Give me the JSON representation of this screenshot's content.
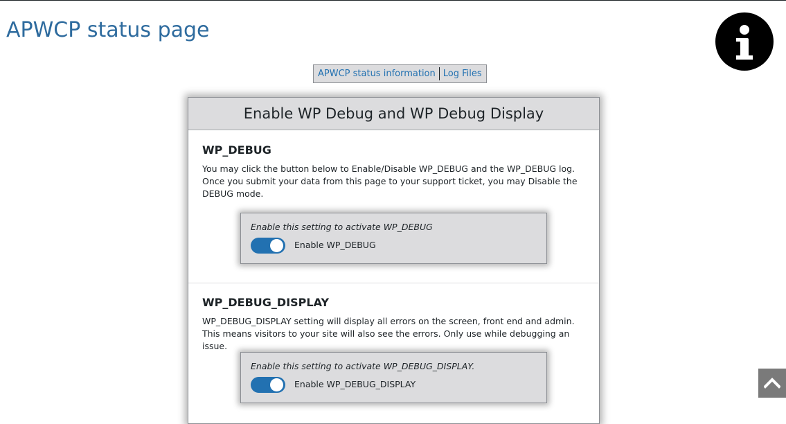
{
  "page": {
    "title": "APWCP status page"
  },
  "icons": {
    "info": "info-icon",
    "scroll_top": "chevron-up-icon"
  },
  "tabs": [
    {
      "label": "APWCP status information"
    },
    {
      "label": "Log Files"
    }
  ],
  "card": {
    "title": "Enable WP Debug and WP Debug Display",
    "sections": [
      {
        "title": "WP_DEBUG",
        "description": "You may click the button below to Enable/Disable WP_DEBUG and the WP_DEBUG log. Once you submit your data from this page to your support ticket, you may Disable the DEBUG mode.",
        "setting_hint": "Enable this setting to activate WP_DEBUG",
        "toggle_label": "Enable WP_DEBUG",
        "toggle_on": true
      },
      {
        "title": "WP_DEBUG_DISPLAY",
        "description": "WP_DEBUG_DISPLAY setting will display all errors on the screen, front end and admin. This means visitors to your site will also see the errors. Only use while debugging an issue.",
        "setting_hint": "Enable this setting to activate WP_DEBUG_DISPLAY.",
        "toggle_label": "Enable WP_DEBUG_DISPLAY",
        "toggle_on": true
      }
    ]
  },
  "colors": {
    "title_blue": "#2e6b9e",
    "link_blue": "#2271b1",
    "toggle_on": "#2271b1",
    "panel_gray": "#dcdcde",
    "scroll_button": "#7a7a7a"
  }
}
